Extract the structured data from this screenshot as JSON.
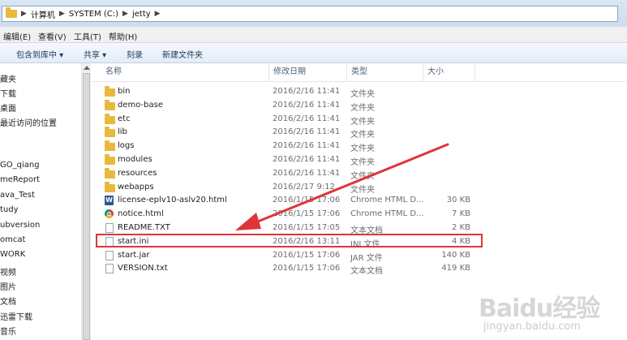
{
  "address": {
    "crumbs": [
      "计算机",
      "SYSTEM (C:)",
      "jetty"
    ]
  },
  "menu": [
    "编辑(E)",
    "查看(V)",
    "工具(T)",
    "帮助(H)"
  ],
  "toolbar": {
    "include_library": "包含到库中 ▾",
    "share": "共享 ▾",
    "burn": "刻录",
    "new_folder": "新建文件夹"
  },
  "nav_items": [
    "藏夹",
    "下载",
    "桌面",
    "最近访问的位置",
    "",
    "",
    "GO_qiang",
    "meReport",
    "ava_Test",
    "tudy",
    "ubversion",
    "omcat",
    "WORK",
    "视频",
    "图片",
    "文档",
    "迅雷下载",
    "音乐"
  ],
  "columns": {
    "name": "名称",
    "date": "修改日期",
    "type": "类型",
    "size": "大小"
  },
  "files": [
    {
      "name": "bin",
      "date": "2016/2/16 11:41",
      "type": "文件夹",
      "size": "",
      "icon": "folder"
    },
    {
      "name": "demo-base",
      "date": "2016/2/16 11:41",
      "type": "文件夹",
      "size": "",
      "icon": "folder"
    },
    {
      "name": "etc",
      "date": "2016/2/16 11:41",
      "type": "文件夹",
      "size": "",
      "icon": "folder"
    },
    {
      "name": "lib",
      "date": "2016/2/16 11:41",
      "type": "文件夹",
      "size": "",
      "icon": "folder"
    },
    {
      "name": "logs",
      "date": "2016/2/16 11:41",
      "type": "文件夹",
      "size": "",
      "icon": "folder"
    },
    {
      "name": "modules",
      "date": "2016/2/16 11:41",
      "type": "文件夹",
      "size": "",
      "icon": "folder"
    },
    {
      "name": "resources",
      "date": "2016/2/16 11:41",
      "type": "文件夹",
      "size": "",
      "icon": "folder"
    },
    {
      "name": "webapps",
      "date": "2016/2/17 9:12",
      "type": "文件夹",
      "size": "",
      "icon": "folder"
    },
    {
      "name": "license-eplv10-aslv20.html",
      "date": "2016/1/15 17:06",
      "type": "Chrome HTML D...",
      "size": "30 KB",
      "icon": "word"
    },
    {
      "name": "notice.html",
      "date": "2016/1/15 17:06",
      "type": "Chrome HTML D...",
      "size": "7 KB",
      "icon": "chrome"
    },
    {
      "name": "README.TXT",
      "date": "2016/1/15 17:05",
      "type": "文本文档",
      "size": "2 KB",
      "icon": "doc"
    },
    {
      "name": "start.ini",
      "date": "2016/2/16 13:11",
      "type": "INI 文件",
      "size": "4 KB",
      "icon": "doc"
    },
    {
      "name": "start.jar",
      "date": "2016/1/15 17:06",
      "type": "JAR 文件",
      "size": "140 KB",
      "icon": "doc"
    },
    {
      "name": "VERSION.txt",
      "date": "2016/1/15 17:06",
      "type": "文本文档",
      "size": "419 KB",
      "icon": "doc"
    }
  ],
  "watermark": {
    "main": "Baidu经验",
    "sub": "jingyan.baidu.com"
  },
  "colors": {
    "highlight": "#e0343a",
    "arrow": "#e0343a",
    "folder": "#e8b93d"
  }
}
